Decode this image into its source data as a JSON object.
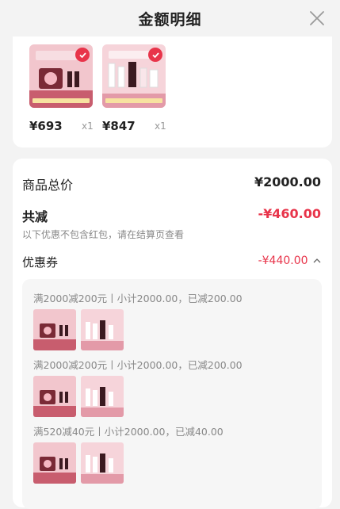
{
  "header": {
    "title": "金额明细",
    "close_icon": "close-icon"
  },
  "products": [
    {
      "price": "¥693",
      "qty": "x1",
      "image": "gift-set-image",
      "selected": true
    },
    {
      "price": "¥847",
      "qty": "x1",
      "image": "gift-set-image",
      "selected": true
    }
  ],
  "summary": {
    "total_label": "商品总价",
    "total_value": "¥2000.00",
    "discount_label": "共减",
    "discount_value": "-¥460.00",
    "discount_note": "以下优惠不包含红包，请在结算页查看",
    "coupon_label": "优惠券",
    "coupon_value": "-¥440.00"
  },
  "coupons": [
    {
      "text": "满2000减200元丨小计2000.00，已减200.00"
    },
    {
      "text": "满2000减200元丨小计2000.00，已减200.00"
    },
    {
      "text": "满520减40元丨小计2000.00，已减40.00"
    }
  ],
  "colors": {
    "accent": "#e8344a",
    "product_pink": "#e9a6b1",
    "product_dark": "#7a2a36"
  }
}
